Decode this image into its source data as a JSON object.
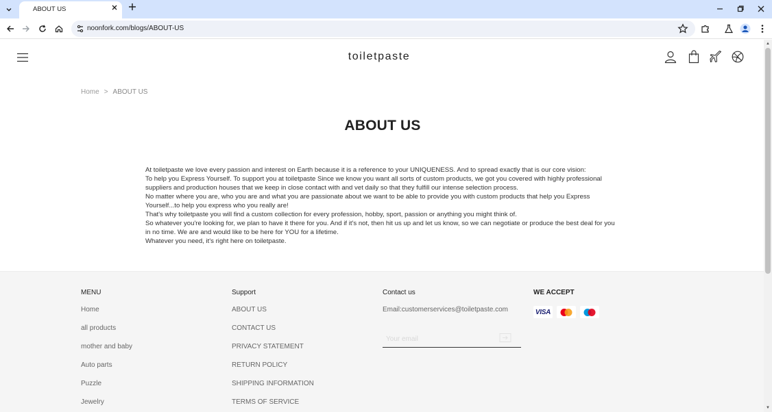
{
  "browser": {
    "tab_title": "ABOUT US",
    "url": "noonfork.com/blogs/ABOUT-US"
  },
  "site": {
    "brand": "toiletpaste"
  },
  "breadcrumb": {
    "home": "Home",
    "separator": ">",
    "current": "ABOUT US"
  },
  "page": {
    "title": "ABOUT US",
    "paragraphs": [
      "At toiletpaste we love every passion and interest on Earth because it is a reference to your UNIQUENESS. And to spread exactly that is our core vision:",
      "To help you Express Yourself. To support you at toiletpaste Since we know you want all sorts of custom products, we got you covered with highly professional suppliers and production houses that we keep in close contact with and vet daily so that they fulfill our intense selection process.",
      "No matter where you are, who you are and what you are passionate about we want to be able to provide you with custom products that help you Express Yourself...to help you express who you really are!",
      "That's why toiletpaste you will find a custom collection for every profession, hobby, sport, passion or anything you might think of.",
      "So whatever you're looking for, we plan to have it there for you. And if it's not, then hit us up and let us know, so we can negotiate or produce the best deal for you in no time. We are and would like to be here for YOU for a lifetime.",
      "Whatever you need, it's right here on toiletpaste."
    ]
  },
  "footer": {
    "menu": {
      "heading": "MENU",
      "items": [
        "Home",
        "all products",
        "mother and baby",
        "Auto parts",
        "Puzzle",
        "Jewelry"
      ]
    },
    "support": {
      "heading": "Support",
      "items": [
        "ABOUT US",
        "CONTACT US",
        "PRIVACY STATEMENT",
        "RETURN POLICY",
        "SHIPPING INFORMATION",
        "TERMS OF SERVICE"
      ]
    },
    "contact": {
      "heading": "Contact us",
      "email": "Email:customerservices@toiletpaste.com",
      "subscribe_placeholder": "Your email"
    },
    "payments": {
      "heading": "WE ACCEPT",
      "visa_label": "VISA"
    }
  },
  "colors": {
    "tabstrip": "#d3e3fd",
    "mastercard_red": "#eb001b",
    "mastercard_yellow": "#f79e1b",
    "maestro_blue": "#0099df",
    "maestro_red": "#e2001a",
    "visa_blue": "#1a1f71"
  }
}
